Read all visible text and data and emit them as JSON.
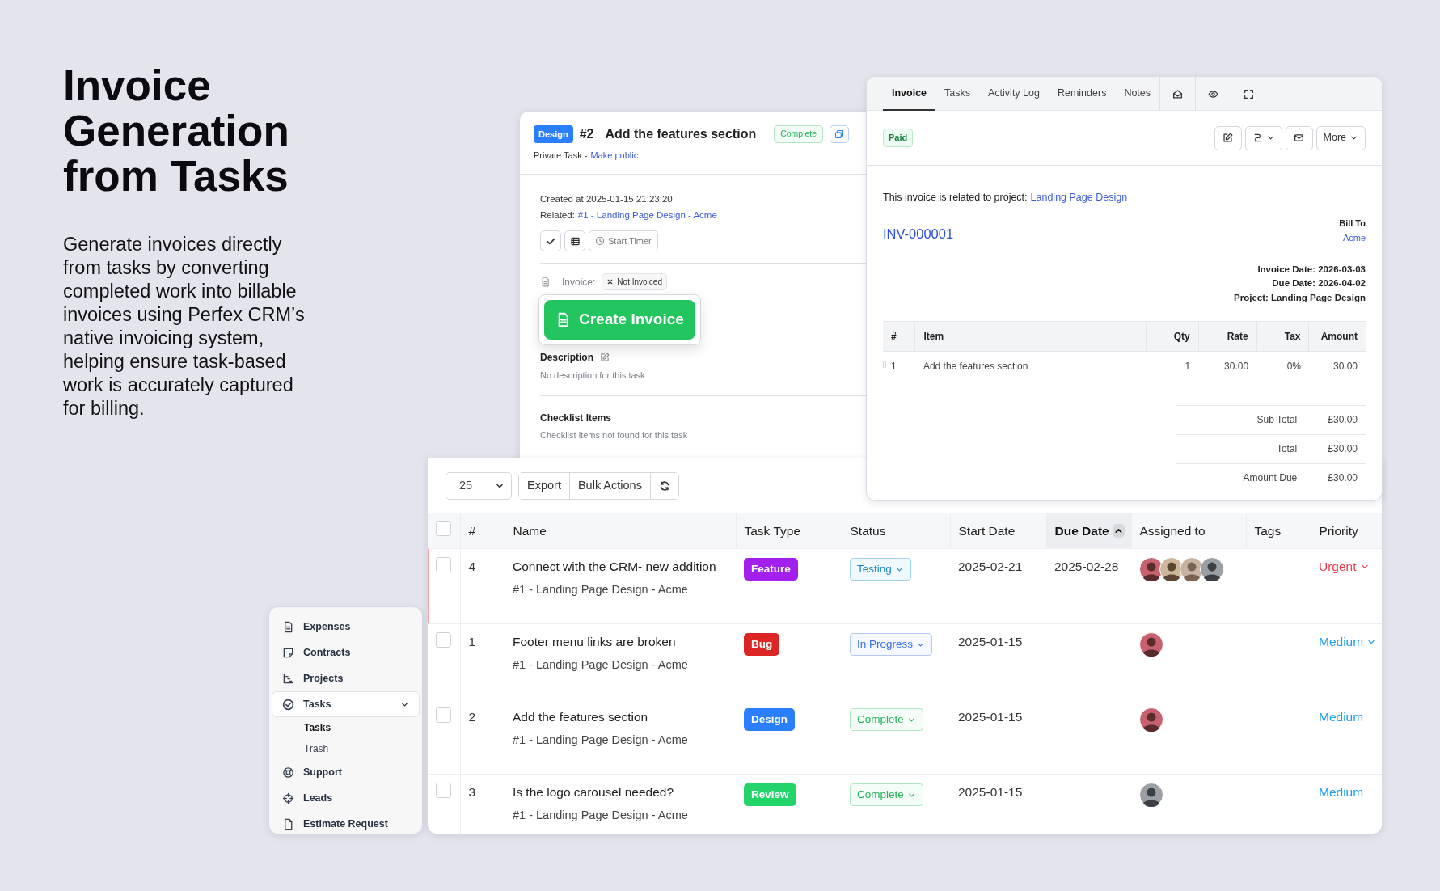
{
  "headline": {
    "title": "Invoice Generation from Tasks",
    "body": "Generate invoices directly from tasks by converting completed work into billable invoices using Perfex CRM’s native invoicing system, helping ensure task-based work is accurately captured for billing."
  },
  "task_panel": {
    "type_badge": {
      "label": "Design",
      "color": "#2b7fff"
    },
    "number": "#2",
    "title": "Add the features section",
    "status": {
      "label": "Complete",
      "kind": "complete"
    },
    "privacy": "Private Task -",
    "privacy_link": "Make public",
    "created": "Created at 2025-01-15 21:23:20",
    "related_label": "Related:",
    "related_link": "#1 - Landing Page Design - Acme",
    "timer_button": "Start Timer",
    "invoice_label": "Invoice:",
    "invoice_status": "Not Invoiced",
    "create_button": "Create Invoice",
    "description_title": "Description",
    "description_text": "No description for this task",
    "checklist_title": "Checklist Items",
    "checklist_text": "Checklist items not found for this task"
  },
  "invoice_panel": {
    "tabs": [
      {
        "label": "Invoice",
        "selected": true
      },
      {
        "label": "Tasks",
        "selected": false
      },
      {
        "label": "Activity Log",
        "selected": false
      },
      {
        "label": "Reminders",
        "selected": false
      },
      {
        "label": "Notes",
        "selected": false
      }
    ],
    "status": "Paid",
    "more_button": "More",
    "related_text": "This invoice is related to project:",
    "related_link": "Landing Page Design",
    "number": "INV-000001",
    "bill_to_label": "Bill To",
    "bill_to": "Acme",
    "meta": [
      "Invoice Date: 2026-03-03",
      "Due Date: 2026-04-02",
      "Project: Landing Page Design"
    ],
    "columns": [
      "#",
      "Item",
      "Qty",
      "Rate",
      "Tax",
      "Amount"
    ],
    "items": [
      [
        "1",
        "Add the features section",
        "1",
        "30.00",
        "0%",
        "30.00"
      ]
    ],
    "totals": [
      {
        "label": "Sub Total",
        "value": "£30.00"
      },
      {
        "label": "Total",
        "value": "£30.00"
      },
      {
        "label": "Amount Due",
        "value": "£30.00"
      }
    ]
  },
  "tasks_table": {
    "page_size": "25",
    "buttons": [
      "Export",
      "Bulk Actions"
    ],
    "select_all_checked": false,
    "columns": [
      {
        "label": "#",
        "sorted": false
      },
      {
        "label": "Name",
        "sorted": false
      },
      {
        "label": "Task Type",
        "sorted": false
      },
      {
        "label": "Status",
        "sorted": false
      },
      {
        "label": "Start Date",
        "sorted": false
      },
      {
        "label": "Due Date",
        "sorted": true
      },
      {
        "label": "Assigned to",
        "sorted": false
      },
      {
        "label": "Tags",
        "sorted": false
      },
      {
        "label": "Priority",
        "sorted": false
      }
    ],
    "rows": [
      {
        "checked": false,
        "highlighted": true,
        "number": "4",
        "name": "Connect with the CRM- new addition",
        "project": "#1 - Landing Page Design - Acme",
        "task_type": {
          "label": "Feature",
          "color": "#a21fed"
        },
        "status": {
          "label": "Testing",
          "kind": "testing"
        },
        "start_date": "2025-02-21",
        "due_date": "2025-02-28",
        "priority": {
          "label": "Urgent",
          "kind": "urgent",
          "caret": true
        }
      },
      {
        "checked": false,
        "highlighted": false,
        "number": "1",
        "name": "Footer menu links are broken",
        "project": "#1 - Landing Page Design - Acme",
        "task_type": {
          "label": "Bug",
          "color": "#dc2626"
        },
        "status": {
          "label": "In Progress",
          "kind": "in_progress"
        },
        "start_date": "2025-01-15",
        "priority": {
          "label": "Medium",
          "kind": "medium",
          "caret": true
        }
      },
      {
        "checked": false,
        "highlighted": false,
        "number": "2",
        "name": "Add the features section",
        "project": "#1 - Landing Page Design - Acme",
        "task_type": {
          "label": "Design",
          "color": "#2b7fff"
        },
        "status": {
          "label": "Complete",
          "kind": "complete"
        },
        "start_date": "2025-01-15",
        "priority": {
          "label": "Medium",
          "kind": "medium",
          "caret": false
        }
      },
      {
        "checked": false,
        "highlighted": false,
        "number": "3",
        "name": "Is the logo carousel needed?",
        "project": "#1 - Landing Page Design - Acme",
        "task_type": {
          "label": "Review",
          "color": "#22d46a"
        },
        "status": {
          "label": "Complete",
          "kind": "complete"
        },
        "start_date": "2025-01-15",
        "priority": {
          "label": "Medium",
          "kind": "medium",
          "caret": false
        }
      }
    ]
  },
  "sidebar": {
    "items": [
      {
        "label": "Expenses",
        "selected": false
      },
      {
        "label": "Contracts",
        "selected": false
      },
      {
        "label": "Projects",
        "selected": false
      },
      {
        "label": "Tasks",
        "selected": true,
        "expanded": true,
        "children": [
          {
            "label": "Tasks",
            "selected": true
          },
          {
            "label": "Trash",
            "selected": false
          }
        ]
      },
      {
        "label": "Support",
        "selected": false
      },
      {
        "label": "Leads",
        "selected": false
      },
      {
        "label": "Estimate Request",
        "selected": false
      }
    ]
  }
}
